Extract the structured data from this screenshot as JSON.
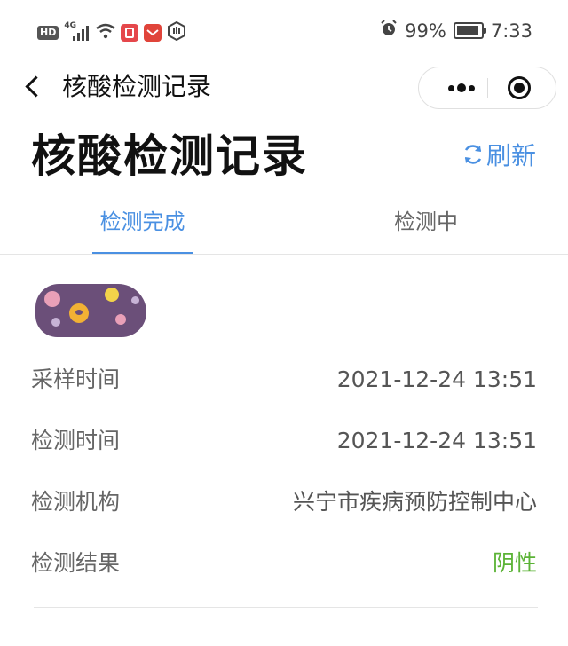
{
  "status_bar": {
    "hd_label": "HD",
    "network_label": "4G",
    "signal_bars": 4,
    "battery_text": "99%",
    "battery_level": 0.99,
    "time": "7:33",
    "icons": [
      "hd-badge",
      "signal-icon",
      "wifi-icon",
      "app-notification-icon",
      "mail-notification-icon",
      "hand-shield-icon",
      "alarm-icon",
      "battery-icon"
    ]
  },
  "nav": {
    "back_icon": "chevron-left-icon",
    "title": "核酸检测记录",
    "more_icon": "more-dots-icon",
    "close_icon": "target-close-icon"
  },
  "header": {
    "title": "核酸检测记录",
    "refresh_label": "刷新",
    "refresh_icon": "refresh-icon",
    "accent_color": "#4a90e2"
  },
  "tabs": [
    {
      "label": "检测完成",
      "active": true
    },
    {
      "label": "检测中",
      "active": false
    }
  ],
  "record": {
    "name_visible": "",
    "rows": [
      {
        "label": "采样时间",
        "value": "2021-12-24 13:51"
      },
      {
        "label": "检测时间",
        "value": "2021-12-24 13:51"
      },
      {
        "label": "检测机构",
        "value": "兴宁市疾病预防控制中心"
      },
      {
        "label": "检测结果",
        "value": "阴性",
        "color": "#5bb336"
      }
    ]
  }
}
